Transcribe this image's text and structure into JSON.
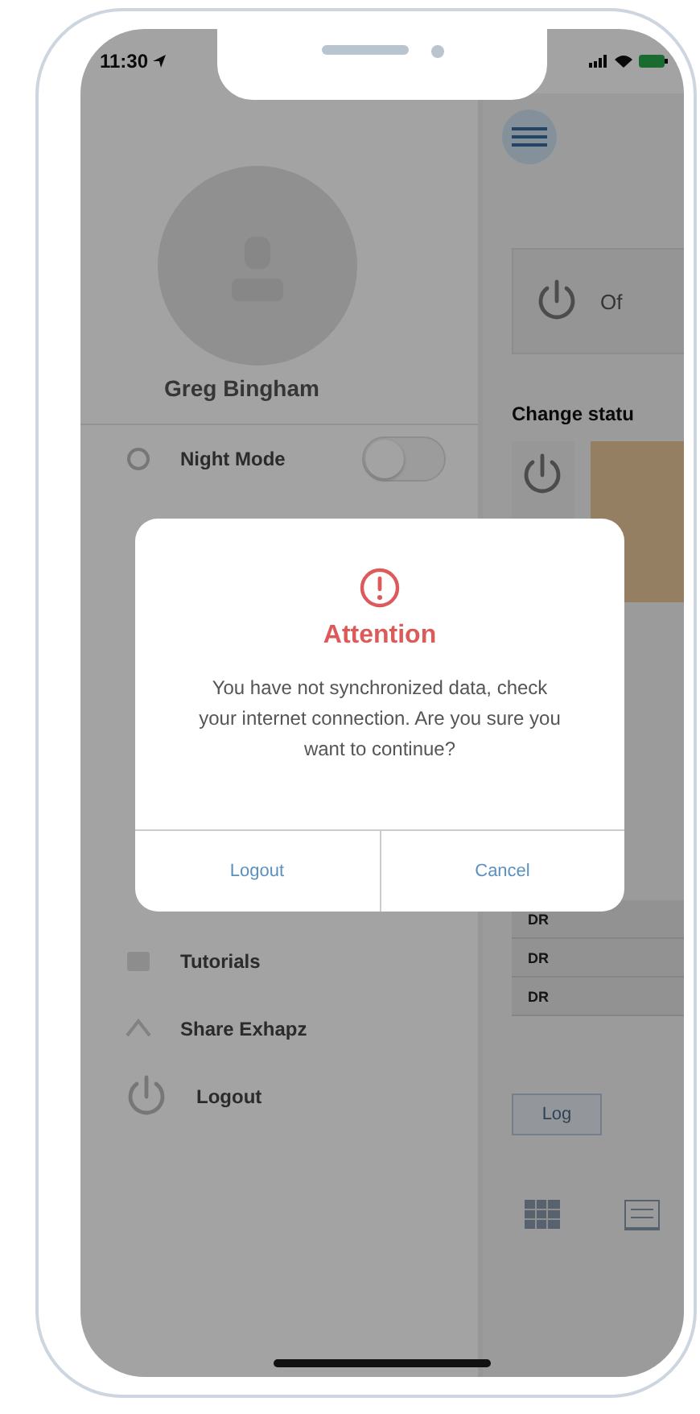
{
  "status_bar": {
    "time": "11:30"
  },
  "drawer": {
    "user_name": "Greg Bingham",
    "items": [
      {
        "kind": "toggle",
        "label": "Night Mode",
        "on": false
      },
      {
        "kind": "link",
        "label": "Tutorials"
      },
      {
        "kind": "link",
        "label": "Share Exhapz"
      },
      {
        "kind": "link",
        "label": "Logout"
      }
    ]
  },
  "main": {
    "power_label": "Of",
    "section_title": "Change statu",
    "table_rows": [
      "DR",
      "DR",
      "DR"
    ],
    "log_button": "Log"
  },
  "dialog": {
    "title": "Attention",
    "message": "You have not synchronized data, check your internet connection. Are you sure you want to continue?",
    "buttons": [
      "Logout",
      "Cancel"
    ]
  }
}
